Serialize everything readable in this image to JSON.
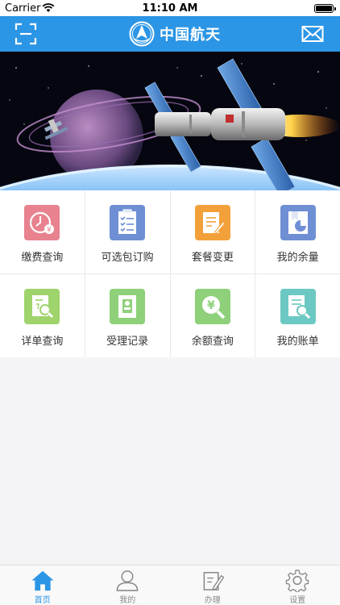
{
  "status_bar": {
    "carrier": "Carrier",
    "time": "11:10 AM"
  },
  "nav": {
    "brand_name": "中国航天",
    "accent_color": "#2b95e6"
  },
  "banner": {
    "image": "satellite-space-station-banner"
  },
  "grid": {
    "items": [
      {
        "label": "缴费查询",
        "icon": "clock-yen-icon",
        "color": "#e8828f"
      },
      {
        "label": "可选包订购",
        "icon": "checklist-icon",
        "color": "#6e8fd4"
      },
      {
        "label": "套餐变更",
        "icon": "edit-document-icon",
        "color": "#f2a13a"
      },
      {
        "label": "我的余量",
        "icon": "pie-document-icon",
        "color": "#6e8fd4"
      },
      {
        "label": "详单查询",
        "icon": "search-document-icon",
        "color": "#9fd36c"
      },
      {
        "label": "受理记录",
        "icon": "record-card-icon",
        "color": "#8fd07a"
      },
      {
        "label": "余额查询",
        "icon": "yen-search-icon",
        "color": "#8fd07a"
      },
      {
        "label": "我的账单",
        "icon": "bill-search-icon",
        "color": "#6cc8c2"
      }
    ]
  },
  "tabs": [
    {
      "label": "首页",
      "icon": "home-icon",
      "active": true
    },
    {
      "label": "我的",
      "icon": "user-icon",
      "active": false
    },
    {
      "label": "办理",
      "icon": "edit-icon",
      "active": false
    },
    {
      "label": "设置",
      "icon": "gear-icon",
      "active": false
    }
  ]
}
